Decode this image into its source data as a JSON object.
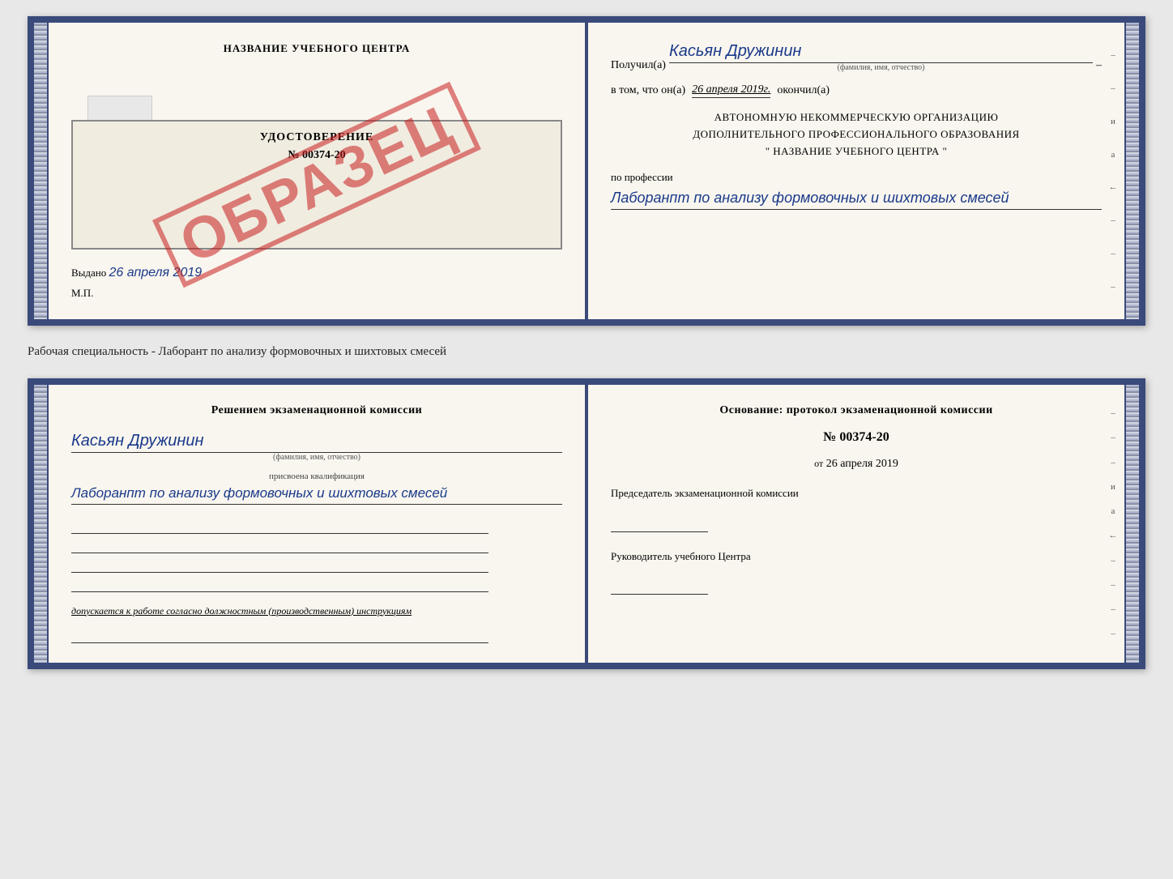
{
  "top_section": {
    "left": {
      "school_name": "НАЗВАНИЕ УЧЕБНОГО ЦЕНТРА",
      "cert_title": "УДОСТОВЕРЕНИЕ",
      "cert_number": "№ 00374-20",
      "stamp_text": "ОБРАЗЕЦ",
      "issue_label": "Выдано",
      "issue_date": "26 апреля 2019",
      "mp_label": "М.П."
    },
    "right": {
      "received_prefix": "Получил(а)",
      "received_name": "Касьян Дружинин",
      "name_sublabel": "(фамилия, имя, отчество)",
      "date_prefix": "в том, что он(а)",
      "date_value": "26 апреля 2019г.",
      "date_suffix": "окончил(а)",
      "org_line1": "АВТОНОМНУЮ НЕКОММЕРЧЕСКУЮ ОРГАНИЗАЦИЮ",
      "org_line2": "ДОПОЛНИТЕЛЬНОГО ПРОФЕССИОНАЛЬНОГО ОБРАЗОВАНИЯ",
      "org_line3": "\"   НАЗВАНИЕ УЧЕБНОГО ЦЕНТРА   \"",
      "profession_prefix": "по профессии",
      "profession_value": "Лаборанпт по анализу формовочных и шихтовых смесей",
      "right_marks": [
        "–",
        "–",
        "и",
        "а",
        "←",
        "–",
        "–",
        "–"
      ]
    }
  },
  "middle": {
    "label": "Рабочая специальность - Лаборант по анализу формовочных и шихтовых смесей"
  },
  "bottom_section": {
    "left": {
      "decision_title": "Решением экзаменационной комиссии",
      "person_name": "Касьян Дружинин",
      "name_sublabel": "(фамилия, имя, отчество)",
      "qual_label": "присвоена квалификация",
      "qual_value": "Лаборанпт по анализу формовочных и шихтовых смесей",
      "admission_text": "допускается к работе согласно должностным (производственным) инструкциям"
    },
    "right": {
      "basis_title": "Основание: протокол экзаменационной комиссии",
      "protocol_number": "№ 00374-20",
      "date_prefix": "от",
      "date_value": "26 апреля 2019",
      "chairman_title": "Председатель экзаменационной комиссии",
      "director_title": "Руководитель учебного Центра",
      "right_marks": [
        "–",
        "–",
        "–",
        "и",
        "а",
        "←",
        "–",
        "–",
        "–",
        "–"
      ]
    }
  }
}
